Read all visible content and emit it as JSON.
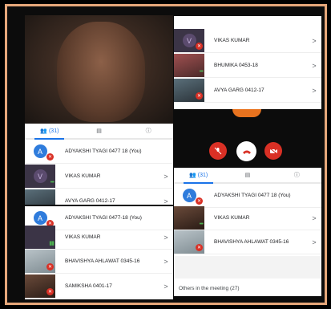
{
  "colors": {
    "border": "#e6a77a",
    "accent": "#1a73e8",
    "mute": "#d93025",
    "avatar_blue": "#2f7cdc"
  },
  "icons": {
    "people": "people-icon",
    "chat": "chat-icon",
    "info": "info-icon",
    "mic_off": "mic-off-icon",
    "end_call": "end-call-icon",
    "camera_off": "camera-off-icon",
    "chevron": "chevron-right-icon"
  },
  "top_right_panel": {
    "rows": [
      {
        "avatar": "V",
        "name": "VIKAS KUMAR",
        "chevron": ">"
      },
      {
        "name": "BHUMIKA 0453-18",
        "chevron": ">"
      },
      {
        "name": "AVYA GARG 0412-17",
        "chevron": ">"
      }
    ]
  },
  "left_panel_1": {
    "tabs": {
      "people_count": "(31)"
    },
    "rows": [
      {
        "avatar": "A",
        "name": "ADYAKSHI TYAGI 0477 18 (You)",
        "chevron": ""
      },
      {
        "avatar": "V",
        "name": "VIKAS KUMAR",
        "chevron": ">"
      },
      {
        "name": "AVYA GARG 0412-17",
        "chevron": ">"
      }
    ]
  },
  "left_panel_2": {
    "rows": [
      {
        "avatar": "A",
        "name": "ADYAKSHI TYAGI 0477-18 (You)",
        "chevron": ""
      },
      {
        "name": "VIKAS KUMAR",
        "chevron": ">"
      },
      {
        "name": "BHAVISHYA AHLAWAT 0345-16",
        "chevron": ">"
      },
      {
        "name": "SAMIKSHA 0401-17",
        "chevron": ">"
      }
    ]
  },
  "right_panel_2": {
    "tabs": {
      "people_count": "(31)"
    },
    "rows": [
      {
        "avatar": "A",
        "name": "ADYAKSHI TYAGI 0477 18 (You)",
        "chevron": ""
      },
      {
        "name": "VIKAS KUMAR",
        "chevron": ">"
      },
      {
        "name": "BHAVISHYA AHLAWAT 0345-16",
        "chevron": ">"
      }
    ],
    "footer": "Others in the meeting (27)"
  }
}
